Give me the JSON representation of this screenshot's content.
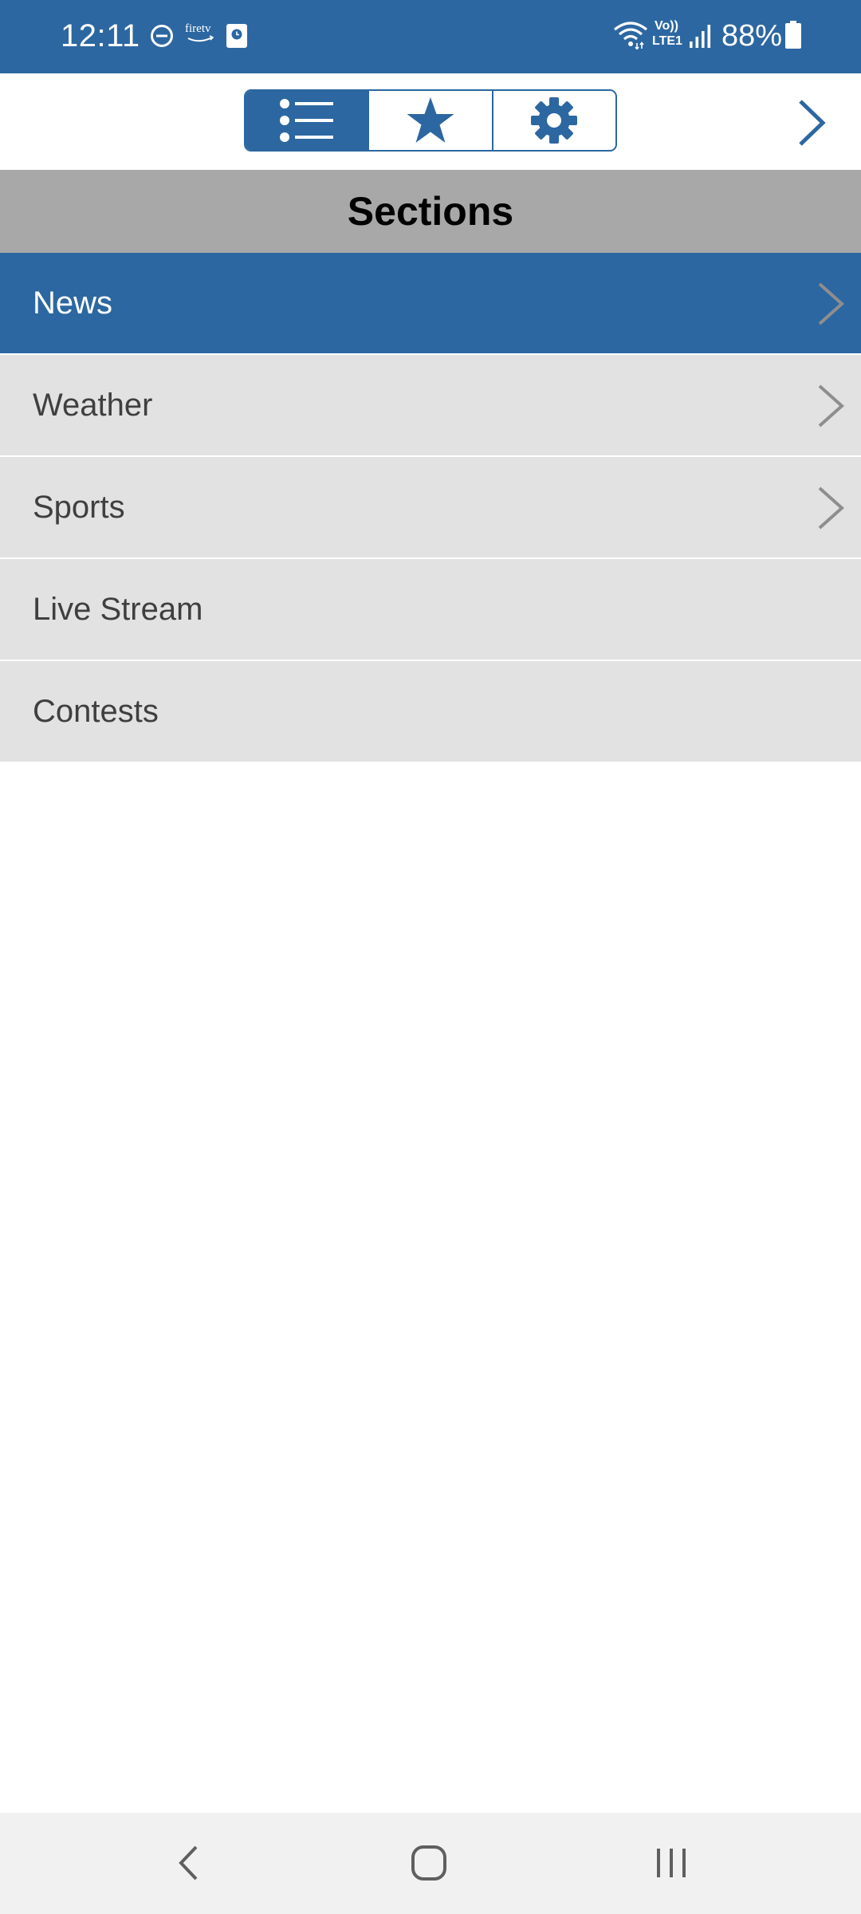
{
  "status_bar": {
    "time": "12:11",
    "battery_percent": "88%",
    "left_icons": [
      "do-not-disturb-icon",
      "fire-tv-icon",
      "clock-app-icon"
    ],
    "right_icons": [
      "wifi-icon",
      "volte-icon",
      "signal-icon",
      "battery-icon"
    ],
    "volte_line1": "Vo))",
    "volte_line2": "LTE1",
    "fire_tv_label": "firetv"
  },
  "toolbar": {
    "tabs": [
      {
        "icon": "list-icon",
        "active": true
      },
      {
        "icon": "star-icon",
        "active": false
      },
      {
        "icon": "gear-icon",
        "active": false
      }
    ],
    "forward_icon": "chevron-right-icon"
  },
  "header": {
    "title": "Sections"
  },
  "sections": {
    "items": [
      {
        "label": "News",
        "has_children": true,
        "selected": true
      },
      {
        "label": "Weather",
        "has_children": true,
        "selected": false
      },
      {
        "label": "Sports",
        "has_children": true,
        "selected": false
      },
      {
        "label": "Live Stream",
        "has_children": false,
        "selected": false
      },
      {
        "label": "Contests",
        "has_children": false,
        "selected": false
      }
    ]
  },
  "nav_bar": {
    "buttons": [
      "back-icon",
      "home-icon",
      "recents-icon"
    ]
  },
  "colors": {
    "brand": "#2c67a1",
    "header_bg": "#a8a8a8",
    "row_bg": "#e3e2e3",
    "row_text": "#3f3f3f",
    "chevron_gray": "#8e8e8e"
  }
}
